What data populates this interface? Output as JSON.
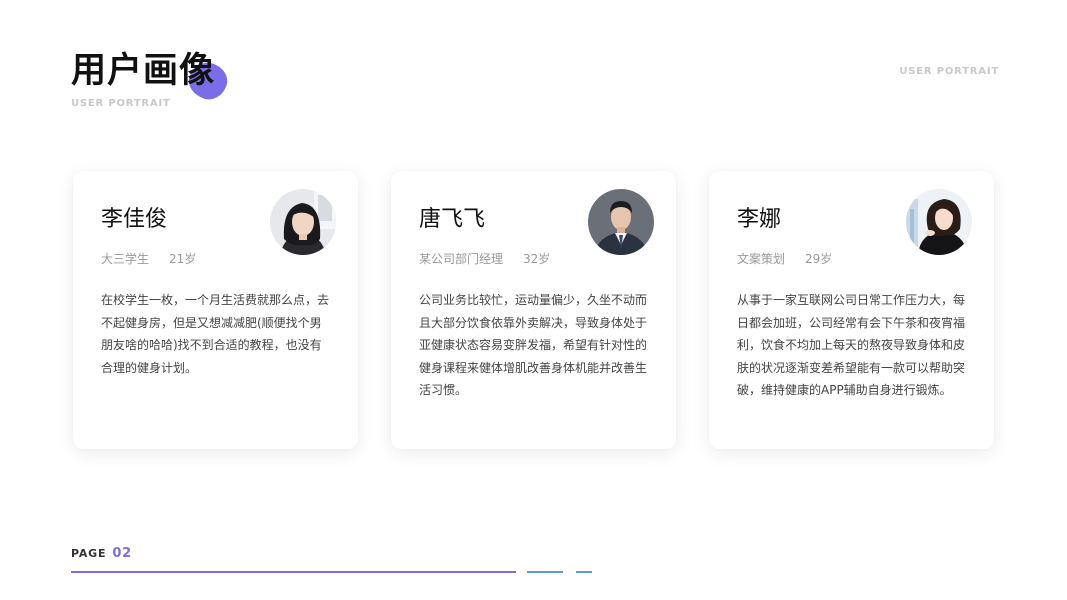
{
  "header": {
    "title": "用户画像",
    "subtitle": "USER PORTRAIT",
    "corner_label": "USER PORTRAIT",
    "accent_color": "#7b6de8"
  },
  "cards": [
    {
      "name": "李佳俊",
      "role": "大三学生",
      "age": "21岁",
      "avatar": "female-portrait-icon",
      "description": "在校学生一枚，一个月生活费就那么点，去不起健身房，但是又想减减肥(顺便找个男朋友啥的哈哈)找不到合适的教程，也没有合理的健身计划。"
    },
    {
      "name": "唐飞飞",
      "role": "某公司部门经理",
      "age": "32岁",
      "avatar": "male-portrait-icon",
      "description": "公司业务比较忙，运动量偏少，久坐不动而且大部分饮食依靠外卖解决，导致身体处于亚健康状态容易变胖发福，希望有针对性的健身课程来健体增肌改善身体机能并改善生活习惯。"
    },
    {
      "name": "李娜",
      "role": "文案策划",
      "age": "29岁",
      "avatar": "female-portrait-icon",
      "description": "从事于一家互联网公司日常工作压力大，每日都会加班，公司经常有会下午茶和夜宵福利，饮食不均加上每天的熬夜导致身体和皮肤的状况逐渐变差希望能有一款可以帮助突破，维持健康的APP辅助自身进行锻炼。"
    }
  ],
  "footer": {
    "page_label": "PAGE",
    "page_number": "02"
  }
}
